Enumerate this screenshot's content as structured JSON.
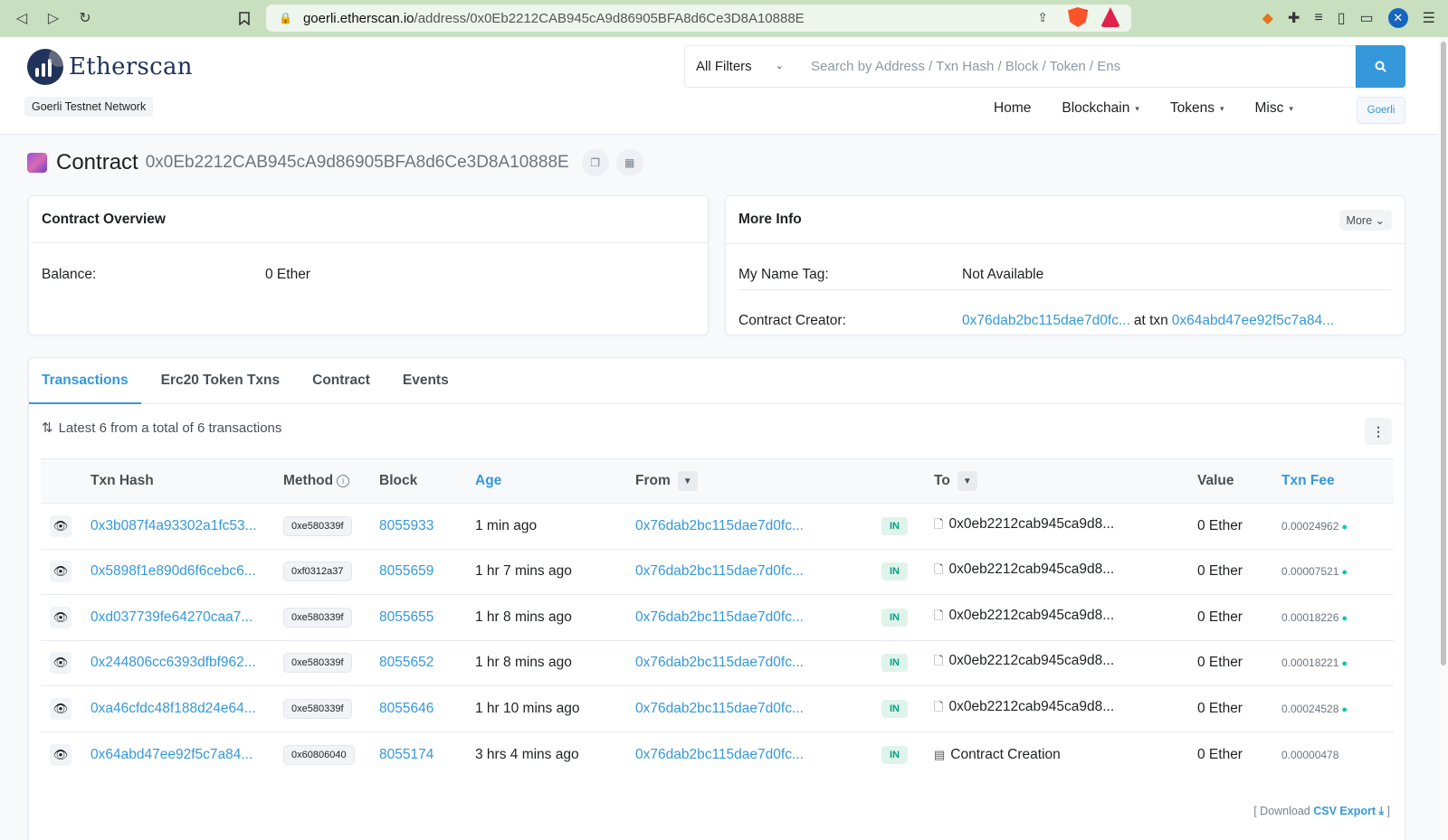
{
  "browser": {
    "url_host": "goerli.etherscan.io",
    "url_path": "/address/0x0Eb2212CAB945cA9d86905BFA8d6Ce3D8A10888E",
    "brave_badge": "1",
    "alert_badge": "1"
  },
  "header": {
    "logo_text": "Etherscan",
    "network": "Goerli Testnet Network",
    "filter_label": "All Filters",
    "search_placeholder": "Search by Address / Txn Hash / Block / Token / Ens",
    "nav": [
      "Home",
      "Blockchain",
      "Tokens",
      "Misc"
    ],
    "network_button": "Goerli"
  },
  "contract": {
    "label": "Contract",
    "address": "0x0Eb2212CAB945cA9d86905BFA8d6Ce3D8A10888E"
  },
  "overview": {
    "title": "Contract Overview",
    "balance_label": "Balance:",
    "balance_value": "0 Ether"
  },
  "more_info": {
    "title": "More Info",
    "more_button": "More",
    "name_tag_label": "My Name Tag:",
    "name_tag_value": "Not Available",
    "creator_label": "Contract Creator:",
    "creator_address": "0x76dab2bc115dae7d0fc...",
    "at_txn": "at txn",
    "creator_txn": "0x64abd47ee92f5c7a84..."
  },
  "tabs": [
    "Transactions",
    "Erc20 Token Txns",
    "Contract",
    "Events"
  ],
  "summary": "Latest 6 from a total of 6 transactions",
  "table": {
    "headers": [
      "Txn Hash",
      "Method",
      "Block",
      "Age",
      "From",
      "To",
      "Value",
      "Txn Fee"
    ],
    "rows": [
      {
        "hash": "0x3b087f4a93302a1fc53...",
        "method": "0xe580339f",
        "block": "8055933",
        "age": "1 min ago",
        "from": "0x76dab2bc115dae7d0fc...",
        "dir": "IN",
        "to": "0x0eb2212cab945ca9d8...",
        "value": "0 Ether",
        "fee": "0.00024962"
      },
      {
        "hash": "0x5898f1e890d6f6cebc6...",
        "method": "0xf0312a37",
        "block": "8055659",
        "age": "1 hr 7 mins ago",
        "from": "0x76dab2bc115dae7d0fc...",
        "dir": "IN",
        "to": "0x0eb2212cab945ca9d8...",
        "value": "0 Ether",
        "fee": "0.00007521"
      },
      {
        "hash": "0xd037739fe64270caa7...",
        "method": "0xe580339f",
        "block": "8055655",
        "age": "1 hr 8 mins ago",
        "from": "0x76dab2bc115dae7d0fc...",
        "dir": "IN",
        "to": "0x0eb2212cab945ca9d8...",
        "value": "0 Ether",
        "fee": "0.00018226"
      },
      {
        "hash": "0x244806cc6393dfbf962...",
        "method": "0xe580339f",
        "block": "8055652",
        "age": "1 hr 8 mins ago",
        "from": "0x76dab2bc115dae7d0fc...",
        "dir": "IN",
        "to": "0x0eb2212cab945ca9d8...",
        "value": "0 Ether",
        "fee": "0.00018221"
      },
      {
        "hash": "0xa46cfdc48f188d24e64...",
        "method": "0xe580339f",
        "block": "8055646",
        "age": "1 hr 10 mins ago",
        "from": "0x76dab2bc115dae7d0fc...",
        "dir": "IN",
        "to": "0x0eb2212cab945ca9d8...",
        "value": "0 Ether",
        "fee": "0.00024528"
      },
      {
        "hash": "0x64abd47ee92f5c7a84...",
        "method": "0x60806040",
        "block": "8055174",
        "age": "3 hrs 4 mins ago",
        "from": "0x76dab2bc115dae7d0fc...",
        "dir": "IN",
        "to": "Contract Creation",
        "value": "0 Ether",
        "fee": "0.00000478"
      }
    ]
  },
  "csv": {
    "prefix": "[ Download",
    "link": "CSV Export",
    "suffix": "]"
  },
  "colors": {
    "accent": "#3498db",
    "navy": "#21325b",
    "in_badge": "#00a186"
  }
}
